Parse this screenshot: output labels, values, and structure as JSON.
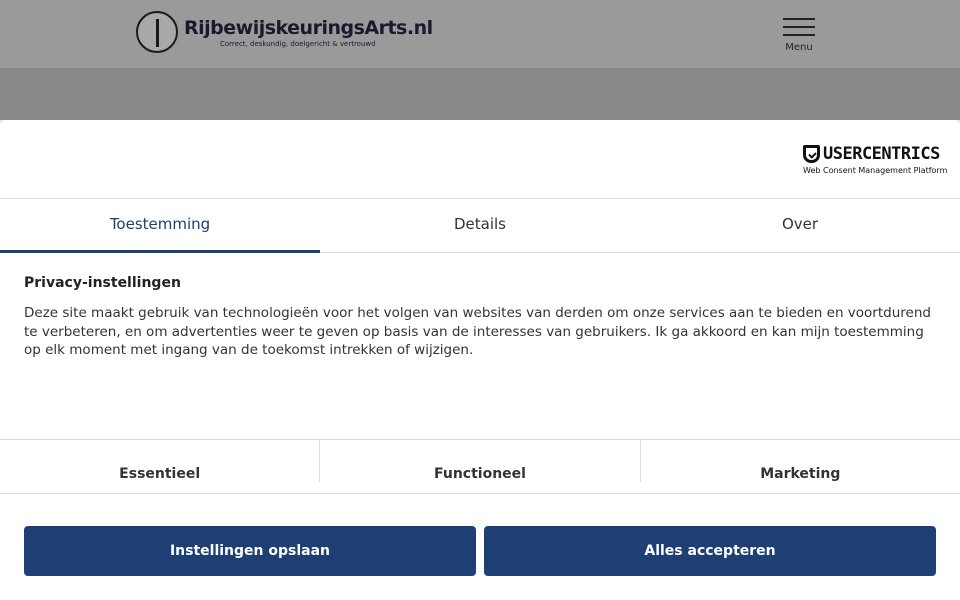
{
  "site": {
    "logo_name": "RijbewijskeuringsArts.nl",
    "logo_tagline": "Correct, deskundig, doelgericht & vertrouwd",
    "menu_label": "Menu"
  },
  "consent": {
    "brand_name": "USERCENTRICS",
    "brand_subtitle": "Web Consent Management Platform",
    "tabs": [
      {
        "label": "Toestemming",
        "active": true
      },
      {
        "label": "Details",
        "active": false
      },
      {
        "label": "Over",
        "active": false
      }
    ],
    "heading": "Privacy-instellingen",
    "body": "Deze site maakt gebruik van technologieën voor het volgen van websites van derden om onze services aan te bieden en voortdurend te verbeteren, en om advertenties weer te geven op basis van de interesses van gebruikers. Ik ga akkoord en kan mijn toestemming op elk moment met ingang van de toekomst intrekken of wijzigen.",
    "categories": [
      "Essentieel",
      "Functioneel",
      "Marketing"
    ],
    "buttons": {
      "save": "Instellingen opslaan",
      "accept_all": "Alles accepteren"
    },
    "accent_color": "#1d3f73"
  }
}
